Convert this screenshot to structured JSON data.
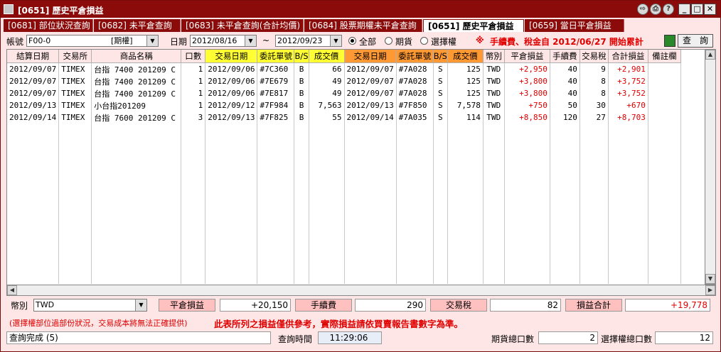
{
  "window": {
    "title": "[0651] 歷史平倉損益"
  },
  "tabs": [
    {
      "label": "[0681] 部位狀況查詢"
    },
    {
      "label": "[0682] 未平倉查詢"
    },
    {
      "label": "[0683] 未平倉查詢(合計均價)"
    },
    {
      "label": "[0684] 股票期權未平倉查詢"
    },
    {
      "label": "[0651] 歷史平倉損益"
    },
    {
      "label": "[0659] 當日平倉損益"
    }
  ],
  "toolbar": {
    "account_label": "帳號",
    "account_value": "F00-0",
    "account_type": "[期權]",
    "date_label": "日期",
    "date_from": "2012/08/16",
    "tilde": "~",
    "date_to": "2012/09/23",
    "radio_all": "全部",
    "radio_futures": "期貨",
    "radio_options": "選擇權",
    "fee_notice_mark": "※",
    "fee_notice": "手續費、稅金自 2012/06/27 開始累計",
    "query_label": "查　詢"
  },
  "table": {
    "headers": [
      "結算日期",
      "交易所",
      "商品名稱",
      "口數",
      "交易日期",
      "委託單號",
      "B/S",
      "成交價",
      "交易日期",
      "委託單號",
      "B/S",
      "成交價",
      "幣別",
      "平倉損益",
      "手續費",
      "交易稅",
      "合計損益",
      "備註欄"
    ],
    "rows": [
      [
        "2012/09/07",
        "TIMEX",
        "台指 7400 201209 C",
        "1",
        "2012/09/06",
        "#7C360",
        "B",
        "66",
        "2012/09/07",
        "#7A028",
        "S",
        "125",
        "TWD",
        "+2,950",
        "40",
        "9",
        "+2,901",
        ""
      ],
      [
        "2012/09/07",
        "TIMEX",
        "台指 7400 201209 C",
        "1",
        "2012/09/06",
        "#7E679",
        "B",
        "49",
        "2012/09/07",
        "#7A028",
        "S",
        "125",
        "TWD",
        "+3,800",
        "40",
        "8",
        "+3,752",
        ""
      ],
      [
        "2012/09/07",
        "TIMEX",
        "台指 7400 201209 C",
        "1",
        "2012/09/06",
        "#7E817",
        "B",
        "49",
        "2012/09/07",
        "#7A028",
        "S",
        "125",
        "TWD",
        "+3,800",
        "40",
        "8",
        "+3,752",
        ""
      ],
      [
        "2012/09/13",
        "TIMEX",
        "小台指201209",
        "1",
        "2012/09/12",
        "#7F984",
        "B",
        "7,563",
        "2012/09/13",
        "#7F850",
        "S",
        "7,578",
        "TWD",
        "+750",
        "50",
        "30",
        "+670",
        ""
      ],
      [
        "2012/09/14",
        "TIMEX",
        "台指 7600 201209 C",
        "3",
        "2012/09/13",
        "#7F825",
        "B",
        "55",
        "2012/09/14",
        "#7A035",
        "S",
        "114",
        "TWD",
        "+8,850",
        "120",
        "27",
        "+8,703",
        ""
      ]
    ]
  },
  "summary": {
    "currency_label": "幣別",
    "currency_value": "TWD",
    "pnl_label": "平倉損益",
    "pnl_value": "+20,150",
    "fee_label": "手續費",
    "fee_value": "290",
    "tax_label": "交易稅",
    "tax_value": "82",
    "total_label": "損益合計",
    "total_value": "+19,778"
  },
  "notes": {
    "left": "(選擇權部位過部份狀況，交易成本將無法正確提供)",
    "right": "此表所列之損益僅供參考，實際損益請依買賣報告書數字為準。"
  },
  "status": {
    "message": "查詢完成 (5)",
    "time_label": "查詢時間",
    "time_value": "11:29:06",
    "futures_count_label": "期貨總口數",
    "futures_count_value": "2",
    "options_count_label": "選擇權總口數",
    "options_count_value": "12"
  },
  "colors": {
    "title_bg": "#8b0a0a",
    "pink_bg": "#ffe6e6",
    "yellow_header": "#ffff33",
    "orange_header": "#ff9933",
    "profit_red": "#e00000"
  }
}
